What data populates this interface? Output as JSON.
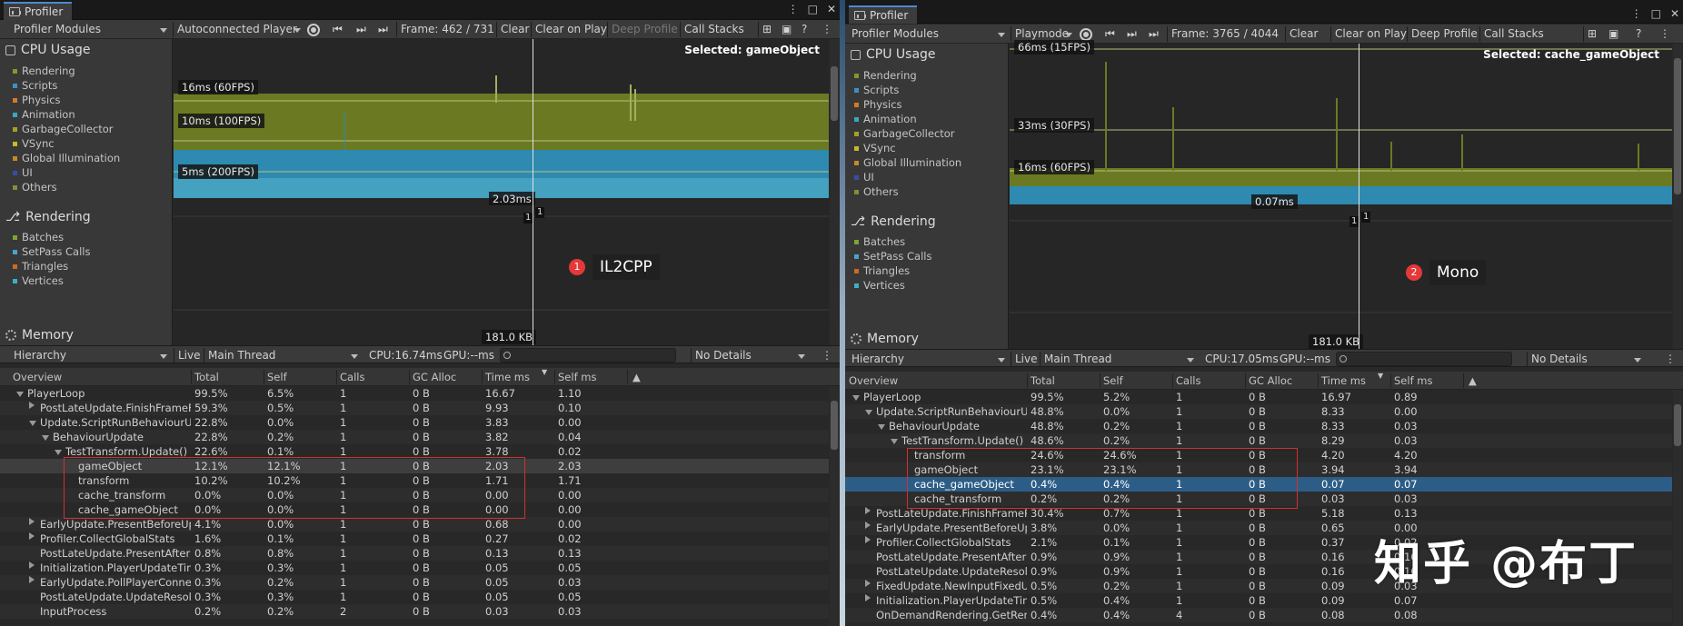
{
  "colors": {
    "rendering": "#7d9a2c",
    "scripts": "#3d8fc8",
    "physics": "#d67a24",
    "animation": "#3aa6c6",
    "gc": "#a3a028",
    "vsync": "#c9b82a",
    "gi": "#c28a2c",
    "ui": "#3b4ca8",
    "others": "#8a8a3a",
    "batches": "#7ea432",
    "setpass": "#4aa2cc",
    "triangles": "#d06a1e",
    "vertices": "#3ab0c8",
    "selection": "#2c5d87",
    "highlight_box": "#d03030",
    "badge": "#e53838"
  },
  "p1": {
    "tab": "Profiler",
    "toolbar": {
      "modules": "Profiler Modules",
      "target": "Autoconnected Player",
      "frame": "Frame: 462 / 731",
      "clear": "Clear",
      "clear_on_play": "Clear on Play",
      "deep_profile": "Deep Profile",
      "call_stacks": "Call Stacks"
    },
    "cpu": {
      "title": "CPU Usage",
      "legend": [
        "Rendering",
        "Scripts",
        "Physics",
        "Animation",
        "GarbageCollector",
        "VSync",
        "Global Illumination",
        "UI",
        "Others"
      ],
      "lines": [
        "16ms (60FPS)",
        "10ms (100FPS)",
        "5ms (200FPS)"
      ],
      "cursor_value": "2.03ms",
      "selected": "Selected: gameObject"
    },
    "rendering": {
      "title": "Rendering",
      "legend": [
        "Batches",
        "SetPass Calls",
        "Triangles",
        "Vertices"
      ],
      "markers": [
        "1",
        "1"
      ]
    },
    "memory": {
      "title": "Memory",
      "value": "181.0 KB"
    },
    "annotation": {
      "num": "1",
      "label": "IL2CPP"
    },
    "bottom": {
      "view": "Hierarchy",
      "live": "Live",
      "thread": "Main Thread",
      "cpu": "CPU:16.74ms",
      "gpu": "GPU:--ms",
      "details": "No Details"
    },
    "columns": [
      "Overview",
      "Total",
      "Self",
      "Calls",
      "GC Alloc",
      "Time ms",
      "Self ms"
    ],
    "rows": [
      {
        "name": "PlayerLoop",
        "total": "99.5%",
        "self": "6.5%",
        "calls": "1",
        "gc": "0 B",
        "time": "16.67",
        "selfms": "1.10"
      },
      {
        "name": "PostLateUpdate.FinishFrameF",
        "total": "59.3%",
        "self": "0.5%",
        "calls": "1",
        "gc": "0 B",
        "time": "9.93",
        "selfms": "0.10"
      },
      {
        "name": "Update.ScriptRunBehaviourU",
        "total": "22.8%",
        "self": "0.0%",
        "calls": "1",
        "gc": "0 B",
        "time": "3.83",
        "selfms": "0.00"
      },
      {
        "name": "BehaviourUpdate",
        "total": "22.8%",
        "self": "0.2%",
        "calls": "1",
        "gc": "0 B",
        "time": "3.82",
        "selfms": "0.04"
      },
      {
        "name": "TestTransform.Update()",
        "total": "22.6%",
        "self": "0.1%",
        "calls": "1",
        "gc": "0 B",
        "time": "3.78",
        "selfms": "0.02"
      },
      {
        "name": "gameObject",
        "total": "12.1%",
        "self": "12.1%",
        "calls": "1",
        "gc": "0 B",
        "time": "2.03",
        "selfms": "2.03"
      },
      {
        "name": "transform",
        "total": "10.2%",
        "self": "10.2%",
        "calls": "1",
        "gc": "0 B",
        "time": "1.71",
        "selfms": "1.71"
      },
      {
        "name": "cache_transform",
        "total": "0.0%",
        "self": "0.0%",
        "calls": "1",
        "gc": "0 B",
        "time": "0.00",
        "selfms": "0.00"
      },
      {
        "name": "cache_gameObject",
        "total": "0.0%",
        "self": "0.0%",
        "calls": "1",
        "gc": "0 B",
        "time": "0.00",
        "selfms": "0.00"
      },
      {
        "name": "EarlyUpdate.PresentBeforeUp",
        "total": "4.1%",
        "self": "0.0%",
        "calls": "1",
        "gc": "0 B",
        "time": "0.68",
        "selfms": "0.00"
      },
      {
        "name": "Profiler.CollectGlobalStats",
        "total": "1.6%",
        "self": "0.1%",
        "calls": "1",
        "gc": "0 B",
        "time": "0.27",
        "selfms": "0.02"
      },
      {
        "name": "PostLateUpdate.PresentAfterI",
        "total": "0.8%",
        "self": "0.8%",
        "calls": "1",
        "gc": "0 B",
        "time": "0.13",
        "selfms": "0.13"
      },
      {
        "name": "Initialization.PlayerUpdateTim",
        "total": "0.3%",
        "self": "0.3%",
        "calls": "1",
        "gc": "0 B",
        "time": "0.05",
        "selfms": "0.05"
      },
      {
        "name": "EarlyUpdate.PollPlayerConne",
        "total": "0.3%",
        "self": "0.2%",
        "calls": "1",
        "gc": "0 B",
        "time": "0.05",
        "selfms": "0.03"
      },
      {
        "name": "PostLateUpdate.UpdateResol",
        "total": "0.3%",
        "self": "0.3%",
        "calls": "1",
        "gc": "0 B",
        "time": "0.05",
        "selfms": "0.05"
      },
      {
        "name": "InputProcess",
        "total": "0.2%",
        "self": "0.2%",
        "calls": "2",
        "gc": "0 B",
        "time": "0.03",
        "selfms": "0.03"
      }
    ]
  },
  "p2": {
    "tab": "Profiler",
    "toolbar": {
      "modules": "Profiler Modules",
      "target": "Playmode",
      "frame": "Frame: 3765 / 4044",
      "clear": "Clear",
      "clear_on_play": "Clear on Play",
      "deep_profile": "Deep Profile",
      "call_stacks": "Call Stacks"
    },
    "cpu": {
      "title": "CPU Usage",
      "legend": [
        "Rendering",
        "Scripts",
        "Physics",
        "Animation",
        "GarbageCollector",
        "VSync",
        "Global Illumination",
        "UI",
        "Others"
      ],
      "lines": [
        "66ms (15FPS)",
        "33ms (30FPS)",
        "16ms (60FPS)"
      ],
      "cursor_value": "0.07ms",
      "selected": "Selected: cache_gameObject"
    },
    "rendering": {
      "title": "Rendering",
      "legend": [
        "Batches",
        "SetPass Calls",
        "Triangles",
        "Vertices"
      ],
      "markers": [
        "1",
        "1"
      ]
    },
    "memory": {
      "title": "Memory",
      "value": "181.0 KB"
    },
    "annotation": {
      "num": "2",
      "label": "Mono"
    },
    "bottom": {
      "view": "Hierarchy",
      "live": "Live",
      "thread": "Main Thread",
      "cpu": "CPU:17.05ms",
      "gpu": "GPU:--ms",
      "details": "No Details"
    },
    "columns": [
      "Overview",
      "Total",
      "Self",
      "Calls",
      "GC Alloc",
      "Time ms",
      "Self ms"
    ],
    "rows": [
      {
        "name": "PlayerLoop",
        "total": "99.5%",
        "self": "5.2%",
        "calls": "1",
        "gc": "0 B",
        "time": "16.97",
        "selfms": "0.89"
      },
      {
        "name": "Update.ScriptRunBehaviourU",
        "total": "48.8%",
        "self": "0.0%",
        "calls": "1",
        "gc": "0 B",
        "time": "8.33",
        "selfms": "0.00"
      },
      {
        "name": "BehaviourUpdate",
        "total": "48.8%",
        "self": "0.2%",
        "calls": "1",
        "gc": "0 B",
        "time": "8.33",
        "selfms": "0.03"
      },
      {
        "name": "TestTransform.Update()",
        "total": "48.6%",
        "self": "0.2%",
        "calls": "1",
        "gc": "0 B",
        "time": "8.29",
        "selfms": "0.03"
      },
      {
        "name": "transform",
        "total": "24.6%",
        "self": "24.6%",
        "calls": "1",
        "gc": "0 B",
        "time": "4.20",
        "selfms": "4.20"
      },
      {
        "name": "gameObject",
        "total": "23.1%",
        "self": "23.1%",
        "calls": "1",
        "gc": "0 B",
        "time": "3.94",
        "selfms": "3.94"
      },
      {
        "name": "cache_gameObject",
        "total": "0.4%",
        "self": "0.4%",
        "calls": "1",
        "gc": "0 B",
        "time": "0.07",
        "selfms": "0.07"
      },
      {
        "name": "cache_transform",
        "total": "0.2%",
        "self": "0.2%",
        "calls": "1",
        "gc": "0 B",
        "time": "0.03",
        "selfms": "0.03"
      },
      {
        "name": "PostLateUpdate.FinishFrameR",
        "total": "30.4%",
        "self": "0.7%",
        "calls": "1",
        "gc": "0 B",
        "time": "5.18",
        "selfms": "0.13"
      },
      {
        "name": "EarlyUpdate.PresentBeforeUp",
        "total": "3.8%",
        "self": "0.0%",
        "calls": "1",
        "gc": "0 B",
        "time": "0.65",
        "selfms": "0.00"
      },
      {
        "name": "Profiler.CollectGlobalStats",
        "total": "2.1%",
        "self": "0.1%",
        "calls": "1",
        "gc": "0 B",
        "time": "0.37",
        "selfms": "0.02"
      },
      {
        "name": "PostLateUpdate.PresentAfterI",
        "total": "0.9%",
        "self": "0.9%",
        "calls": "1",
        "gc": "0 B",
        "time": "0.16",
        "selfms": "0.16"
      },
      {
        "name": "PostLateUpdate.UpdateResolu",
        "total": "0.9%",
        "self": "0.9%",
        "calls": "1",
        "gc": "0 B",
        "time": "0.16",
        "selfms": "0.16"
      },
      {
        "name": "FixedUpdate.NewInputFixedU",
        "total": "0.5%",
        "self": "0.2%",
        "calls": "1",
        "gc": "0 B",
        "time": "0.09",
        "selfms": "0.03"
      },
      {
        "name": "Initialization.PlayerUpdateTim",
        "total": "0.5%",
        "self": "0.4%",
        "calls": "1",
        "gc": "0 B",
        "time": "0.09",
        "selfms": "0.07"
      },
      {
        "name": "OnDemandRendering.GetRen",
        "total": "0.4%",
        "self": "0.4%",
        "calls": "4",
        "gc": "0 B",
        "time": "0.08",
        "selfms": "0.08"
      }
    ]
  },
  "watermark": "知乎 @布丁"
}
